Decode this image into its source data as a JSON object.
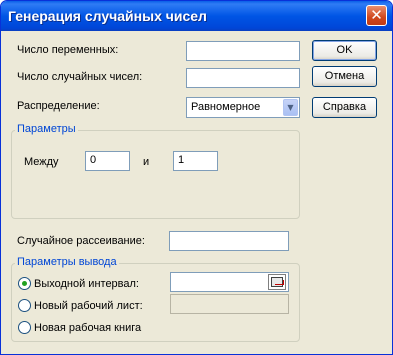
{
  "window": {
    "title": "Генерация случайных чисел",
    "close_glyph": "✕",
    "close_icon": "close-icon"
  },
  "fields": {
    "num_variables_label": "Число переменных:",
    "num_random_label": "Число случайных чисел:",
    "distribution_label": "Распределение:",
    "distribution_value": "Равномерное",
    "random_seed_label": "Случайное рассеивание:"
  },
  "buttons": {
    "ok": "OK",
    "cancel": "Отмена",
    "help": "Справка"
  },
  "parameters": {
    "legend": "Параметры",
    "between_label": "Между",
    "from_value": "0",
    "and_label": "и",
    "to_value": "1"
  },
  "output": {
    "legend": "Параметры вывода",
    "options": [
      {
        "label": "Выходной интервал:",
        "selected": true
      },
      {
        "label": "Новый рабочий лист:",
        "selected": false
      },
      {
        "label": "Новая рабочая книга",
        "selected": false
      }
    ]
  },
  "icons": {
    "dropdown_arrow": "▼",
    "range_picker": "range-picker-icon"
  },
  "colors": {
    "titlebar": "#0055e5",
    "dialog_bg": "#ece9d8",
    "group_legend": "#0046d5",
    "close_button": "#d0471d"
  }
}
